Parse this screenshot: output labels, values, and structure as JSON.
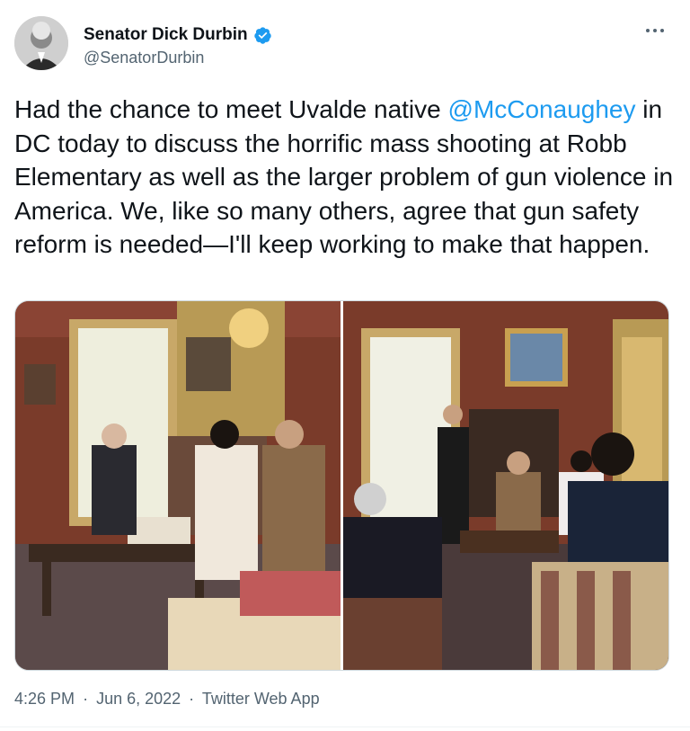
{
  "author": {
    "name": "Senator Dick Durbin",
    "handle": "@SenatorDurbin",
    "verified": true,
    "verified_color": "#1d9bf0"
  },
  "tweet": {
    "text_before": "Had the chance to meet Uvalde native ",
    "mention": "@McConaughey",
    "text_after": " in DC today to discuss the horrific mass shooting at Robb Elementary as well as the larger problem of gun violence in America. We, like so many others, agree that gun safety reform is needed—I'll keep working to make that happen."
  },
  "media": {
    "count": 2,
    "photos": [
      "office-meeting-photo-1",
      "office-meeting-photo-2"
    ]
  },
  "meta": {
    "time": "4:26 PM",
    "sep1": "·",
    "date": "Jun 6, 2022",
    "sep2": "·",
    "source": "Twitter Web App"
  },
  "icons": {
    "more": "more-options-icon",
    "verified": "verified-badge-icon"
  },
  "colors": {
    "text": "#0f1419",
    "secondary": "#536471",
    "link": "#1d9bf0"
  }
}
